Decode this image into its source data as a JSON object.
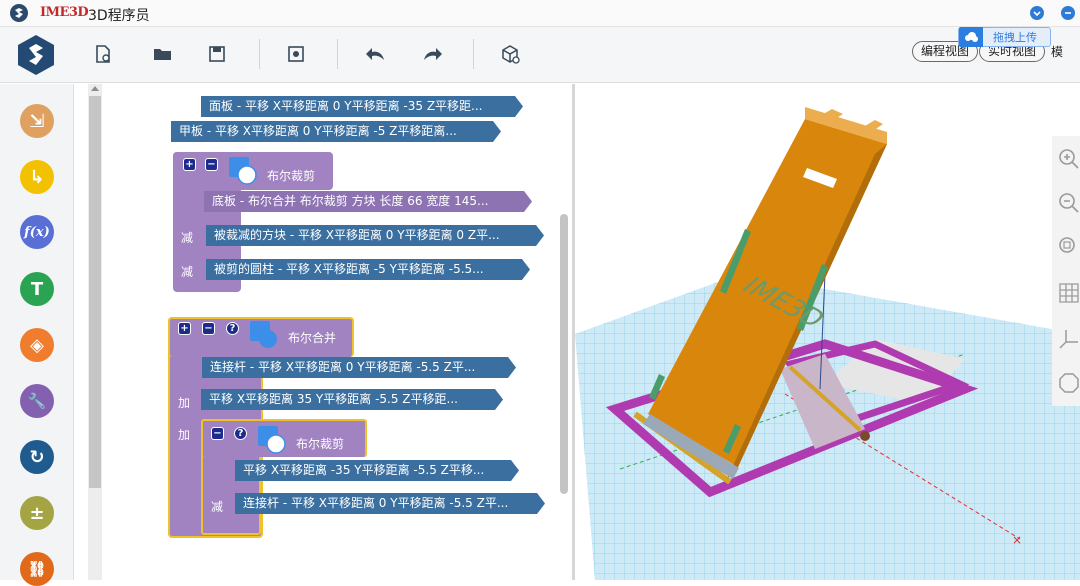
{
  "titlebar": {
    "brand": "IME3D",
    "title": "3D程序员"
  },
  "toolbar": {
    "buttons": [
      "new-file",
      "open-folder",
      "save",
      "settings",
      "undo",
      "redo",
      "3d-model"
    ],
    "view_modes": [
      "编程视图",
      "实时视图",
      "模"
    ],
    "upload_label": "拖拽上传"
  },
  "sidebar": {
    "categories": [
      {
        "name": "transform",
        "color": "#e0a060",
        "glyph": "⇲"
      },
      {
        "name": "move",
        "color": "#f2c100",
        "glyph": "↳"
      },
      {
        "name": "function",
        "color": "#5a6fd6",
        "glyph": "f(x)"
      },
      {
        "name": "text",
        "color": "#2aa452",
        "glyph": "T"
      },
      {
        "name": "shape",
        "color": "#f07d2e",
        "glyph": "◈"
      },
      {
        "name": "tools",
        "color": "#8460b0",
        "glyph": "🔧"
      },
      {
        "name": "loop",
        "color": "#1f5b8e",
        "glyph": "↻"
      },
      {
        "name": "math",
        "color": "#a4a444",
        "glyph": "±"
      },
      {
        "name": "structure",
        "color": "#e06a1a",
        "glyph": "⛓"
      }
    ]
  },
  "blocks": {
    "b1": "面板 - 平移 X平移距离 0 Y平移距离 -35 Z平移距...",
    "b2": "甲板 - 平移 X平移距离 0 Y平移距离 -5 Z平移距离...",
    "group1": {
      "label": "布尔裁剪",
      "child1": "底板 - 布尔合并 布尔裁剪 方块 长度 66 宽度 145...",
      "op2": "减",
      "child2": "被裁减的方块 - 平移 X平移距离 0 Y平移距离 0 Z平...",
      "op3": "减",
      "child3": "被剪的圆柱 - 平移 X平移距离 -5 Y平移距离 -5.5..."
    },
    "group2": {
      "label": "布尔合并",
      "child1": "连接杆 - 平移 X平移距离 0 Y平移距离 -5.5 Z平...",
      "op2": "加",
      "child2": "平移 X平移距离 35 Y平移距离 -5.5 Z平移距...",
      "op3": "加",
      "inner": {
        "label": "布尔裁剪",
        "child1": "平移 X平移距离 -35 Y平移距离 -5.5 Z平移...",
        "op2": "减",
        "child2": "连接杆 - 平移 X平移距离 0 Y平移距离 -5.5 Z平..."
      }
    }
  },
  "model": {
    "engraving": "IME3D"
  },
  "colors": {
    "board": "#d9860c",
    "frame": "#b03ab0",
    "grid": "#7ec8e8",
    "accent_blue": "#2e7bd6"
  }
}
